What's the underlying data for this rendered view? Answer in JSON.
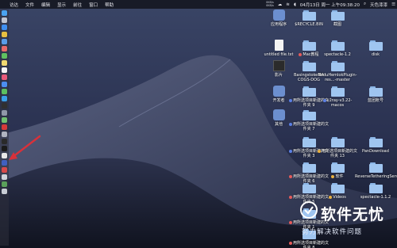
{
  "menubar": {
    "apple": "",
    "items": [
      "访达",
      "文件",
      "编辑",
      "显示",
      "前往",
      "窗口",
      "帮助"
    ],
    "status_mini_1": "0KB/s",
    "status_mini_2": "0KB/s",
    "datetime": "04月13日 周一 上午09:38:20",
    "user": "天色漆漆"
  },
  "desktop_icons": [
    {
      "label": "应用程序",
      "dot": null
    },
    {
      "label": "$RECYCLE.BIN",
      "dot": null
    },
    {
      "label": "截图",
      "dot": null
    },
    {
      "label": "untitled file.txt",
      "dot": null
    },
    {
      "label": "Mac教程",
      "dot": "#e45b5b"
    },
    {
      "label": "spectacle-1.2",
      "dot": null
    },
    {
      "label": "disk",
      "dot": null
    },
    {
      "label": "影片",
      "dot": null
    },
    {
      "label": "BasingstokeMA COGS-DOG",
      "dot": null
    },
    {
      "label": "BoduHemlokPlugin-res...-master",
      "dot": null
    },
    {
      "label": "用所选项目新建的文件夹 9",
      "dot": "#5b7fe4"
    },
    {
      "label": "开发者",
      "dot": null
    },
    {
      "label": "用所选项目新建的文件夹 7",
      "dot": "#5b7fe4"
    },
    {
      "label": "v2ray-v3.22-macos",
      "dot": "#5b7fe4"
    },
    {
      "label": "蓝团账号",
      "dot": null
    },
    {
      "label": "其他",
      "dot": null
    },
    {
      "label": "用所选项目新建的文件夹 3",
      "dot": "#5b7fe4"
    },
    {
      "label": "用所选项目新建的文件夹 13",
      "dot": "#e8b040"
    },
    {
      "label": "PanDownload",
      "dot": null
    },
    {
      "label": "用所选项目新建的文件夹 6",
      "dot": "#e45b5b"
    },
    {
      "label": "软件",
      "dot": "#e8b040"
    },
    {
      "label": "ReverseTetheringServer_1.2.0",
      "dot": null
    },
    {
      "label": "用所选项目新建的文件夹 5",
      "dot": "#e45b5b"
    },
    {
      "label": "Videos",
      "dot": "#e8b040"
    },
    {
      "label": "spectacle-1.1.2",
      "dot": null
    },
    {
      "label": "用所选项目新建的文件夹 1",
      "dot": "#e45b5b"
    },
    {
      "label": "用所选项目新建的文件夹 8",
      "dot": "#e45b5b"
    }
  ],
  "watermark": {
    "title": "软件无忧",
    "subtitle": "努力解决软件问题"
  },
  "colors": {
    "folder": "#9fc5f0",
    "menubar": "#16182a",
    "arrow": "#d8313a",
    "tag_red": "#e45b5b",
    "tag_blue": "#5b7fe4",
    "tag_orange": "#e8b040"
  }
}
